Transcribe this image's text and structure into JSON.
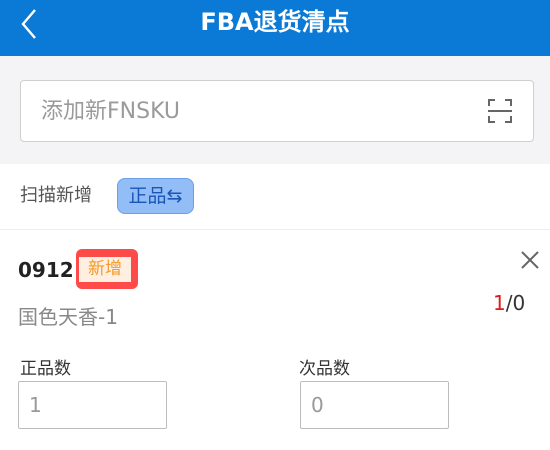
{
  "header": {
    "title": "FBA退货清点",
    "back_icon": "chevron-left-icon",
    "background": "#0a7ad6"
  },
  "search": {
    "placeholder": "添加新FNSKU",
    "value": "",
    "scan_icon": "scan-icon"
  },
  "scan": {
    "label": "扫描新增",
    "toggle_label": "正品⇆"
  },
  "item": {
    "code": "0912",
    "badge": "新增",
    "name": "国色天香-1",
    "count_current": "1",
    "count_total": "/0",
    "close_icon": "close-icon",
    "good_label": "正品数",
    "good_value": "1",
    "defect_label": "次品数",
    "defect_value": "0"
  }
}
